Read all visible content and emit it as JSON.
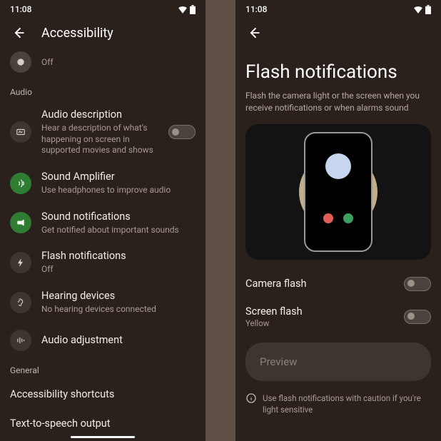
{
  "status": {
    "time": "11:08"
  },
  "left": {
    "title": "Accessibility",
    "partial_off": "Off",
    "sections": {
      "audio": {
        "label": "Audio",
        "items": [
          {
            "title": "Audio description",
            "sub": "Hear a description of what's happening on screen in supported movies and shows",
            "toggle": true,
            "icon": "audio-description-icon"
          },
          {
            "title": "Sound Amplifier",
            "sub": "Use headphones to improve audio",
            "green": true,
            "icon": "sound-amplifier-icon"
          },
          {
            "title": "Sound notifications",
            "sub": "Get notified about important sounds",
            "green": true,
            "icon": "sound-notifications-icon"
          },
          {
            "title": "Flash notifications",
            "sub": "Off",
            "icon": "flash-icon"
          },
          {
            "title": "Hearing devices",
            "sub": "No hearing devices connected",
            "icon": "hearing-devices-icon"
          },
          {
            "title": "Audio adjustment",
            "icon": "audio-adjustment-icon"
          }
        ]
      },
      "general": {
        "label": "General",
        "items": [
          {
            "title": "Accessibility shortcuts"
          },
          {
            "title": "Text-to-speech output"
          }
        ]
      }
    }
  },
  "right": {
    "title": "Flash notifications",
    "subtitle": "Flash the camera light or the screen when you receive notifications or when alarms sound",
    "camera_flash": {
      "label": "Camera flash"
    },
    "screen_flash": {
      "label": "Screen flash",
      "value": "Yellow"
    },
    "preview_label": "Preview",
    "info_text": "Use flash notifications with caution if you're light sensitive"
  }
}
